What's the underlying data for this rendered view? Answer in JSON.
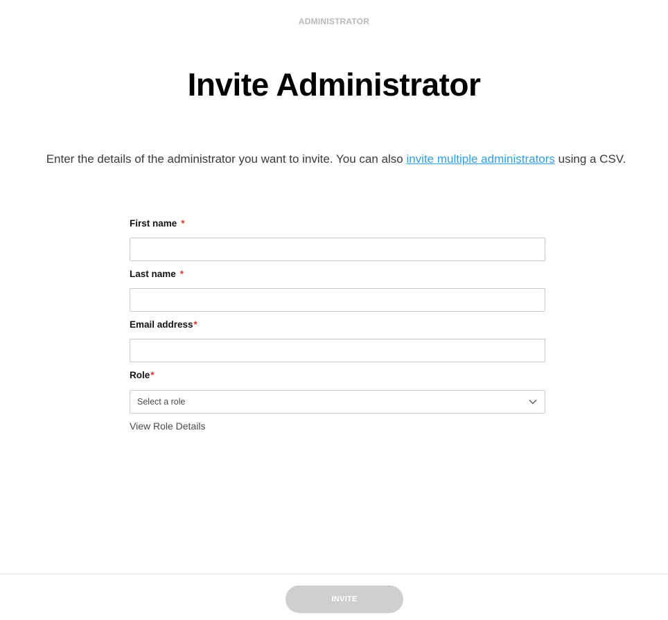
{
  "header": {
    "eyebrow": "ADMINISTRATOR",
    "title": "Invite Administrator"
  },
  "description": {
    "before": "Enter the details of the administrator you want to invite. You can also ",
    "link": "invite multiple administrators",
    "after": " using a CSV."
  },
  "form": {
    "first_name": {
      "label": "First name",
      "required": "*",
      "value": "",
      "placeholder": ""
    },
    "last_name": {
      "label": "Last name",
      "required": "*",
      "value": "",
      "placeholder": ""
    },
    "email": {
      "label": "Email address",
      "required": "*",
      "value": "",
      "placeholder": ""
    },
    "role": {
      "label": "Role",
      "required": "*",
      "selected": "Select a role",
      "icon": "chevron-down-icon"
    },
    "role_details_link": "View Role Details"
  },
  "footer": {
    "invite_label": "INVITE"
  },
  "colors": {
    "link": "#2e9fe0",
    "required": "#e0352b",
    "button_disabled": "#cfcfcf"
  }
}
